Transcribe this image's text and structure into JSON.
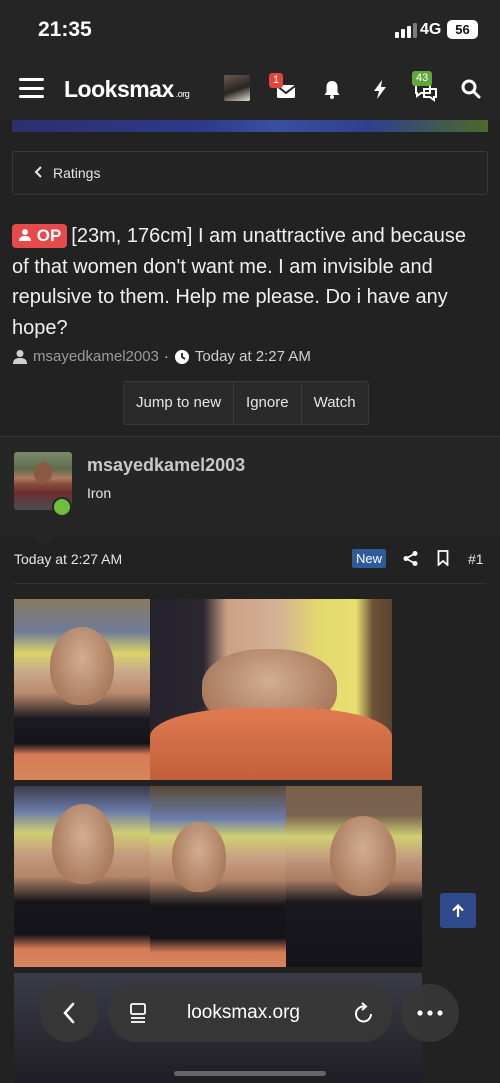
{
  "status": {
    "time": "21:35",
    "network": "4G",
    "battery": "56"
  },
  "nav": {
    "logo": "Looksmax",
    "logo_suffix": ".org",
    "inbox_count": "1",
    "chat_count": "43"
  },
  "breadcrumb": {
    "label": "Ratings"
  },
  "thread": {
    "op_label": "OP",
    "title": "[23m, 176cm] I am unattractive and because of that women don't want me. I am invisible and repulsive to them. Help me please. Do i have any hope?",
    "author": "msayedkamel2003",
    "separator": "·",
    "date": "Today at 2:27 AM",
    "actions": {
      "jump": "Jump to new",
      "ignore": "Ignore",
      "watch": "Watch"
    }
  },
  "post": {
    "username": "msayedkamel2003",
    "rank": "Iron",
    "date": "Today at 2:27 AM",
    "new_label": "New",
    "number": "#1"
  },
  "browser": {
    "url": "looksmax.org"
  },
  "colors": {
    "accent": "#2f4a8a",
    "op_badge": "#e64a4a",
    "online": "#6cc03a",
    "new_tag": "#2e5b9c"
  }
}
